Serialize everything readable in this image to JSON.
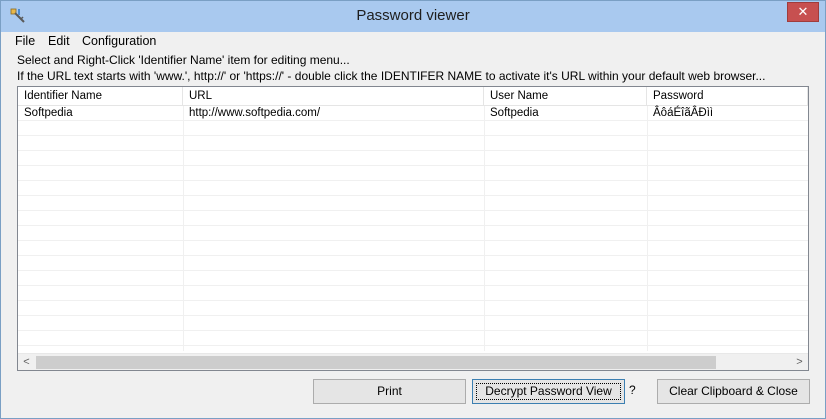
{
  "window": {
    "title": "Password viewer",
    "close_label": "✕"
  },
  "menu": {
    "items": [
      "File",
      "Edit",
      "Configuration"
    ]
  },
  "info": {
    "line1": "Select and Right-Click 'Identifier Name' item for editing menu...",
    "line2": "If the URL text starts with 'www.', http://' or 'https://' - double click the IDENTIFER NAME to activate it's URL within your default web browser..."
  },
  "table": {
    "columns": [
      "Identifier Name",
      "URL",
      "User Name",
      "Password"
    ],
    "rows": [
      [
        "Softpedia",
        "http://www.softpedia.com/",
        "Softpedia",
        "ÂôáÉîãÂÐìì"
      ]
    ]
  },
  "scrollbar": {
    "left_arrow": "<",
    "right_arrow": ">"
  },
  "buttons": {
    "print": "Print",
    "decrypt": "Decrypt Password View",
    "help": "?",
    "clear": "Clear Clipboard & Close"
  },
  "colors": {
    "titlebar": "#a9c9ef",
    "close_button": "#c75050",
    "window_bg": "#f0f0f0"
  }
}
